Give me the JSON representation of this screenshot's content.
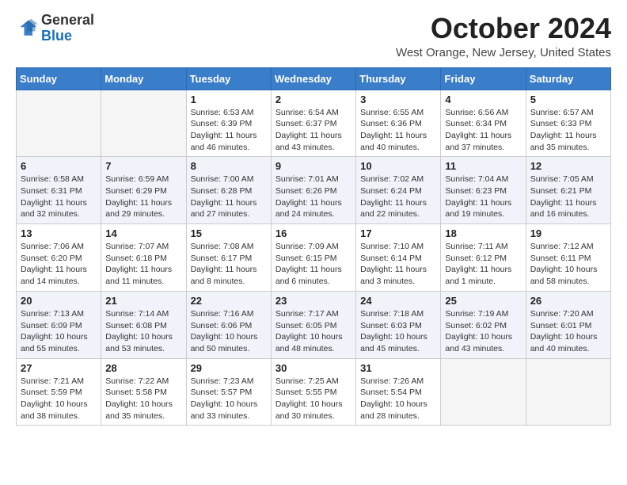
{
  "header": {
    "logo_general": "General",
    "logo_blue": "Blue",
    "month_title": "October 2024",
    "location": "West Orange, New Jersey, United States"
  },
  "weekdays": [
    "Sunday",
    "Monday",
    "Tuesday",
    "Wednesday",
    "Thursday",
    "Friday",
    "Saturday"
  ],
  "weeks": [
    [
      {
        "day": "",
        "detail": ""
      },
      {
        "day": "",
        "detail": ""
      },
      {
        "day": "1",
        "detail": "Sunrise: 6:53 AM\nSunset: 6:39 PM\nDaylight: 11 hours and 46 minutes."
      },
      {
        "day": "2",
        "detail": "Sunrise: 6:54 AM\nSunset: 6:37 PM\nDaylight: 11 hours and 43 minutes."
      },
      {
        "day": "3",
        "detail": "Sunrise: 6:55 AM\nSunset: 6:36 PM\nDaylight: 11 hours and 40 minutes."
      },
      {
        "day": "4",
        "detail": "Sunrise: 6:56 AM\nSunset: 6:34 PM\nDaylight: 11 hours and 37 minutes."
      },
      {
        "day": "5",
        "detail": "Sunrise: 6:57 AM\nSunset: 6:33 PM\nDaylight: 11 hours and 35 minutes."
      }
    ],
    [
      {
        "day": "6",
        "detail": "Sunrise: 6:58 AM\nSunset: 6:31 PM\nDaylight: 11 hours and 32 minutes."
      },
      {
        "day": "7",
        "detail": "Sunrise: 6:59 AM\nSunset: 6:29 PM\nDaylight: 11 hours and 29 minutes."
      },
      {
        "day": "8",
        "detail": "Sunrise: 7:00 AM\nSunset: 6:28 PM\nDaylight: 11 hours and 27 minutes."
      },
      {
        "day": "9",
        "detail": "Sunrise: 7:01 AM\nSunset: 6:26 PM\nDaylight: 11 hours and 24 minutes."
      },
      {
        "day": "10",
        "detail": "Sunrise: 7:02 AM\nSunset: 6:24 PM\nDaylight: 11 hours and 22 minutes."
      },
      {
        "day": "11",
        "detail": "Sunrise: 7:04 AM\nSunset: 6:23 PM\nDaylight: 11 hours and 19 minutes."
      },
      {
        "day": "12",
        "detail": "Sunrise: 7:05 AM\nSunset: 6:21 PM\nDaylight: 11 hours and 16 minutes."
      }
    ],
    [
      {
        "day": "13",
        "detail": "Sunrise: 7:06 AM\nSunset: 6:20 PM\nDaylight: 11 hours and 14 minutes."
      },
      {
        "day": "14",
        "detail": "Sunrise: 7:07 AM\nSunset: 6:18 PM\nDaylight: 11 hours and 11 minutes."
      },
      {
        "day": "15",
        "detail": "Sunrise: 7:08 AM\nSunset: 6:17 PM\nDaylight: 11 hours and 8 minutes."
      },
      {
        "day": "16",
        "detail": "Sunrise: 7:09 AM\nSunset: 6:15 PM\nDaylight: 11 hours and 6 minutes."
      },
      {
        "day": "17",
        "detail": "Sunrise: 7:10 AM\nSunset: 6:14 PM\nDaylight: 11 hours and 3 minutes."
      },
      {
        "day": "18",
        "detail": "Sunrise: 7:11 AM\nSunset: 6:12 PM\nDaylight: 11 hours and 1 minute."
      },
      {
        "day": "19",
        "detail": "Sunrise: 7:12 AM\nSunset: 6:11 PM\nDaylight: 10 hours and 58 minutes."
      }
    ],
    [
      {
        "day": "20",
        "detail": "Sunrise: 7:13 AM\nSunset: 6:09 PM\nDaylight: 10 hours and 55 minutes."
      },
      {
        "day": "21",
        "detail": "Sunrise: 7:14 AM\nSunset: 6:08 PM\nDaylight: 10 hours and 53 minutes."
      },
      {
        "day": "22",
        "detail": "Sunrise: 7:16 AM\nSunset: 6:06 PM\nDaylight: 10 hours and 50 minutes."
      },
      {
        "day": "23",
        "detail": "Sunrise: 7:17 AM\nSunset: 6:05 PM\nDaylight: 10 hours and 48 minutes."
      },
      {
        "day": "24",
        "detail": "Sunrise: 7:18 AM\nSunset: 6:03 PM\nDaylight: 10 hours and 45 minutes."
      },
      {
        "day": "25",
        "detail": "Sunrise: 7:19 AM\nSunset: 6:02 PM\nDaylight: 10 hours and 43 minutes."
      },
      {
        "day": "26",
        "detail": "Sunrise: 7:20 AM\nSunset: 6:01 PM\nDaylight: 10 hours and 40 minutes."
      }
    ],
    [
      {
        "day": "27",
        "detail": "Sunrise: 7:21 AM\nSunset: 5:59 PM\nDaylight: 10 hours and 38 minutes."
      },
      {
        "day": "28",
        "detail": "Sunrise: 7:22 AM\nSunset: 5:58 PM\nDaylight: 10 hours and 35 minutes."
      },
      {
        "day": "29",
        "detail": "Sunrise: 7:23 AM\nSunset: 5:57 PM\nDaylight: 10 hours and 33 minutes."
      },
      {
        "day": "30",
        "detail": "Sunrise: 7:25 AM\nSunset: 5:55 PM\nDaylight: 10 hours and 30 minutes."
      },
      {
        "day": "31",
        "detail": "Sunrise: 7:26 AM\nSunset: 5:54 PM\nDaylight: 10 hours and 28 minutes."
      },
      {
        "day": "",
        "detail": ""
      },
      {
        "day": "",
        "detail": ""
      }
    ]
  ]
}
